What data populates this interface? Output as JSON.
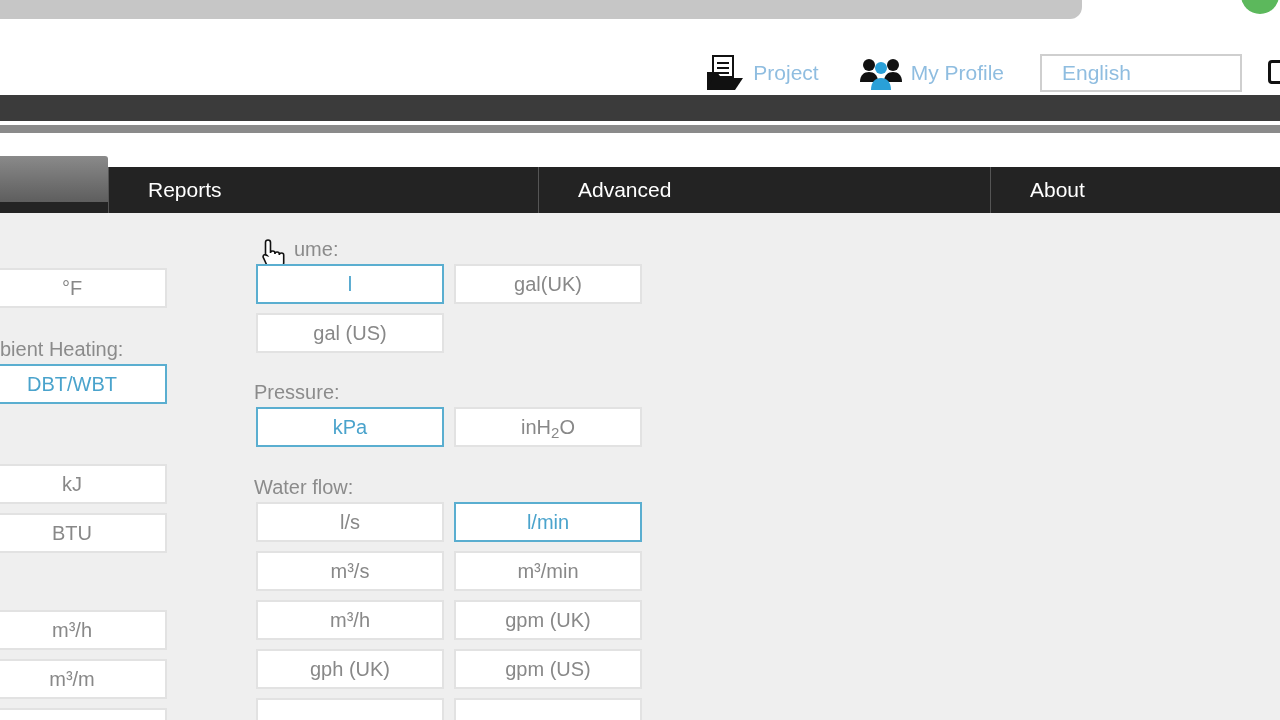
{
  "header": {
    "links": [
      {
        "kind": "project",
        "label": "Project"
      },
      {
        "kind": "profile",
        "label": "My Profile"
      }
    ],
    "language": {
      "value": "English"
    }
  },
  "nav": [
    {
      "selected": true
    },
    {
      "label": "Reports",
      "selected": false
    },
    {
      "label": "Advanced",
      "selected": false
    },
    {
      "label": "About",
      "selected": false
    }
  ],
  "columns": [
    {
      "sections": [
        {
          "options": [
            {
              "label": "°F",
              "selected": false
            }
          ]
        },
        {
          "label": "bient Heating:",
          "options": [
            {
              "label": "DBT/WBT",
              "selected": true
            }
          ]
        },
        {
          "options": [
            {
              "label": "kJ",
              "selected": false
            },
            {
              "label": "BTU",
              "selected": false
            }
          ]
        },
        {
          "options": [
            {
              "label": "m³/h",
              "selected": false
            },
            {
              "label": "m³/m",
              "selected": false
            },
            {
              "selected": false
            }
          ]
        }
      ]
    },
    {
      "sections": [
        {
          "label": "ume:",
          "cursor_over": true,
          "options": [
            {
              "label": "l",
              "selected": true
            },
            {
              "label": "gal(UK)",
              "selected": false
            },
            {
              "label": "gal (US)",
              "selected": false
            }
          ]
        },
        {
          "label": "Pressure:",
          "options": [
            {
              "label": "kPa",
              "selected": true
            },
            {
              "label": "inH$_{2}$O",
              "selected": false
            }
          ]
        },
        {
          "label": "Water flow:",
          "options": [
            {
              "label": "l/s",
              "selected": false
            },
            {
              "label": "l/min",
              "selected": true
            },
            {
              "label": "m³/s",
              "selected": false
            },
            {
              "label": "m³/min",
              "selected": false
            },
            {
              "label": "m³/h",
              "selected": false
            },
            {
              "label": "gpm (UK)",
              "selected": false
            },
            {
              "label": "gph (UK)",
              "selected": false
            },
            {
              "label": "gpm (US)",
              "selected": false
            },
            {
              "selected": false
            },
            {
              "selected": false
            }
          ]
        }
      ]
    }
  ]
}
